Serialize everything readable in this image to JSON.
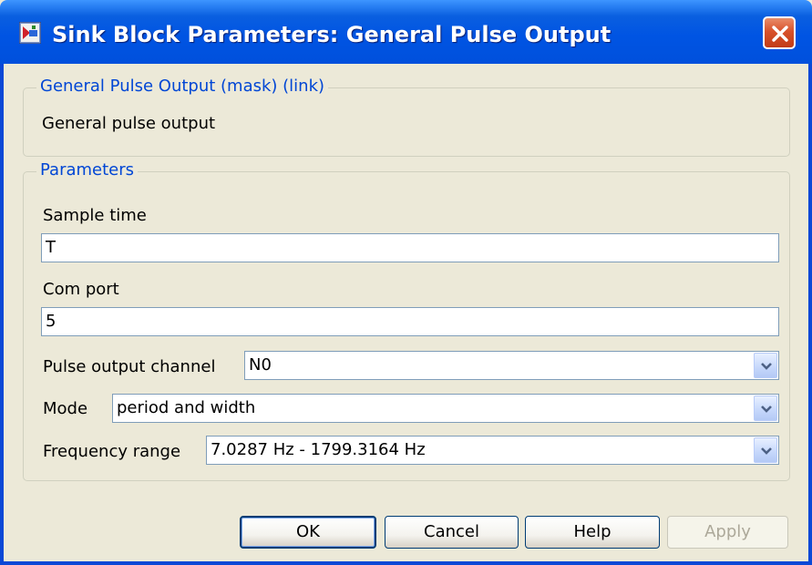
{
  "window": {
    "title": "Sink Block Parameters: General Pulse Output",
    "close_icon": "close-icon",
    "app_icon": "simulink-block-icon"
  },
  "description_group": {
    "legend": "General Pulse Output (mask) (link)",
    "text": "General pulse output"
  },
  "parameters_group": {
    "legend": "Parameters",
    "sample_time": {
      "label": "Sample time",
      "value": "T"
    },
    "com_port": {
      "label": "Com port",
      "value": "5"
    },
    "pulse_output_channel": {
      "label": "Pulse output channel",
      "value": "N0"
    },
    "mode": {
      "label": "Mode",
      "value": "period and width"
    },
    "frequency_range": {
      "label": "Frequency range",
      "value": "7.0287 Hz - 1799.3164 Hz"
    }
  },
  "buttons": {
    "ok": "OK",
    "cancel": "Cancel",
    "help": "Help",
    "apply": "Apply"
  },
  "colors": {
    "title_bar": "#0054E3",
    "dialog_bg": "#ECE9D8",
    "legend_text": "#0046D5",
    "close_button": "#D8512B"
  }
}
